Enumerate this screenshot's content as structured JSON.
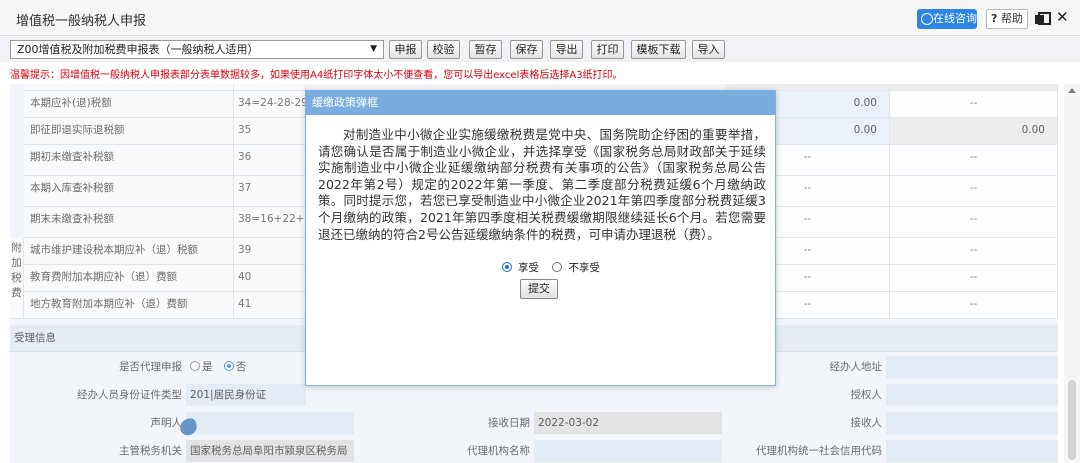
{
  "window": {
    "title": "增值税一般纳税人申报",
    "consult_label": "在线咨询",
    "help_label": "帮助"
  },
  "toolbar": {
    "form_select_value": "Z00增值税及附加税费申报表（一般纳税人适用）",
    "buttons": [
      "申报",
      "校验",
      "暂存",
      "保存",
      "导出",
      "打印",
      "模板下载",
      "导入"
    ]
  },
  "warning": "温馨提示：因增值税一般纳税人申报表部分表单数据较多，如果使用A4纸打印字体太小不便查看，您可以导出excel表格后选择A3纸打印。",
  "table": {
    "rows": [
      {
        "name": "本期应补(退)税额",
        "no": "34=24-28-29",
        "c1": "",
        "c2": "0.00",
        "c3": "--"
      },
      {
        "name": "即征即退实际退税额",
        "no": "35",
        "c1": "",
        "c2": "0.00",
        "c3": "0.00"
      },
      {
        "name": "期初未缴查补税额",
        "no": "36",
        "c1": "",
        "c2": "--",
        "c3": "--"
      },
      {
        "name": "本期入库查补税额",
        "no": "37",
        "c1": "",
        "c2": "--",
        "c3": "--"
      },
      {
        "name": "期末未缴查补税额",
        "no": "38=16+22+36-37",
        "c1": "",
        "c2": "--",
        "c3": "--"
      },
      {
        "name": "城市维护建设税本期应补（退）税额",
        "no": "39",
        "c1": "",
        "c2": "--",
        "c3": "--"
      },
      {
        "name": "教育费附加本期应补（退）费额",
        "no": "40",
        "c1": "",
        "c2": "--",
        "c3": "--"
      },
      {
        "name": "地方教育附加本期应补（退）费额",
        "no": "41",
        "c1": "",
        "c2": "--",
        "c3": "--"
      }
    ],
    "side_label": "附加税费"
  },
  "acceptance": {
    "section_title": "受理信息",
    "agent_declare_label": "是否代理申报",
    "agent_yes": "是",
    "agent_no": "否",
    "agent_selected": "否",
    "id_type_label": "经办人员身份证件类型",
    "id_type_value": "201|居民身份证",
    "declarant_label": "声明人",
    "receive_date_label": "接收日期",
    "receive_date_value": "2022-03-02",
    "tax_authority_label": "主管税务机关",
    "tax_authority_value": "国家税务总局阜阳市颍泉区税务局",
    "agency_name_label": "代理机构名称",
    "agency_credit_label": "代理机构统一社会信用代码",
    "agent_address_label": "经办人地址",
    "authorizer_label": "授权人",
    "receiver_label": "接收人"
  },
  "modal": {
    "title": "缓缴政策弹框",
    "body": "对制造业中小微企业实施缓缴税费是党中央、国务院助企纾困的重要举措，请您确认是否属于制造业小微企业，并选择享受《国家税务总局财政部关于延续实施制造业中小微企业延缓缴纳部分税费有关事项的公告》（国家税务总局公告2022年第2号）规定的2022年第一季度、第二季度部分税费延缓6个月缴纳政策。同时提示您，若您已享受制造业中小微企业2021年第四季度部分税费延缓3个月缴纳的政策，2021年第四季度相关税费缓缴期限继续延长6个月。若您需要退还已缴纳的符合2号公告延缓缴纳条件的税费，可申请办理退税（费）。",
    "option_enjoy": "享受",
    "option_not_enjoy": "不享受",
    "selected_option": "享受",
    "submit_label": "提交"
  }
}
